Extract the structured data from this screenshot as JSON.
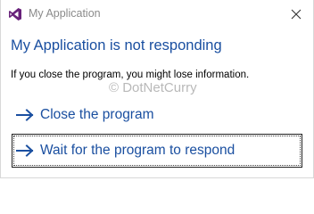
{
  "window": {
    "title": "My Application",
    "app_icon": "visual-studio-icon",
    "close_icon": "close-icon"
  },
  "dialog": {
    "heading": "My Application is not responding",
    "message": "If you close the program, you might lose information.",
    "watermark": "© DotNetCurry"
  },
  "options": [
    {
      "label": "Close the program",
      "icon": "arrow-right-icon"
    },
    {
      "label": "Wait for the program to respond",
      "icon": "arrow-right-icon"
    }
  ],
  "colors": {
    "accent": "#1a4fa0",
    "title_text": "#8a8a8a",
    "watermark": "#b9b9b9"
  }
}
